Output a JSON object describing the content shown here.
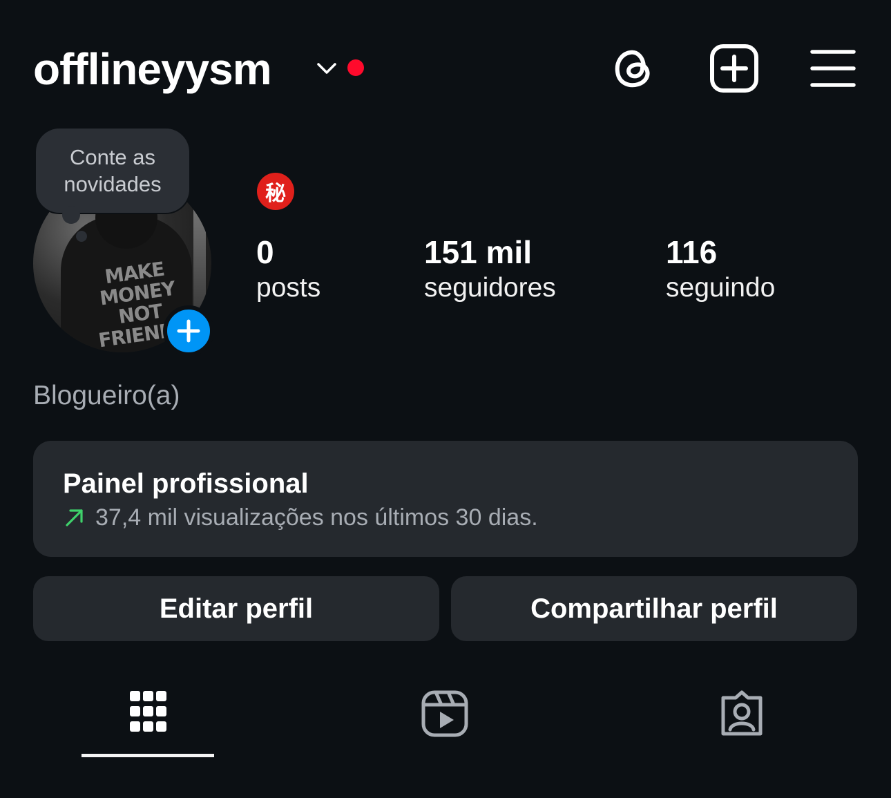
{
  "header": {
    "username": "offlineyysm",
    "notification_dot_color": "#ff0a2c",
    "icons": [
      "chevron-down-icon",
      "threads-icon",
      "add-post-icon",
      "menu-icon"
    ]
  },
  "profile": {
    "bubble_text": "Conte as novidades",
    "avatar_shirt_text": "MAKE MONEY NOT FRIENDS",
    "badge": "秘",
    "stats": {
      "posts_count": "0",
      "posts_label": "posts",
      "followers_count": "151 mil",
      "followers_label": "seguidores",
      "following_count": "116",
      "following_label": "seguindo"
    },
    "category": "Blogueiro(a)"
  },
  "panel": {
    "title": "Painel profissional",
    "subtitle": "37,4 mil visualizações nos últimos 30 dias."
  },
  "buttons": {
    "edit": "Editar perfil",
    "share": "Compartilhar perfil"
  },
  "tabs": [
    "grid-icon",
    "reels-icon",
    "tagged-icon"
  ],
  "colors": {
    "background": "#0c1014",
    "card": "#25292e",
    "accent_blue": "#0095f6",
    "trend_green": "#3fd26b"
  }
}
